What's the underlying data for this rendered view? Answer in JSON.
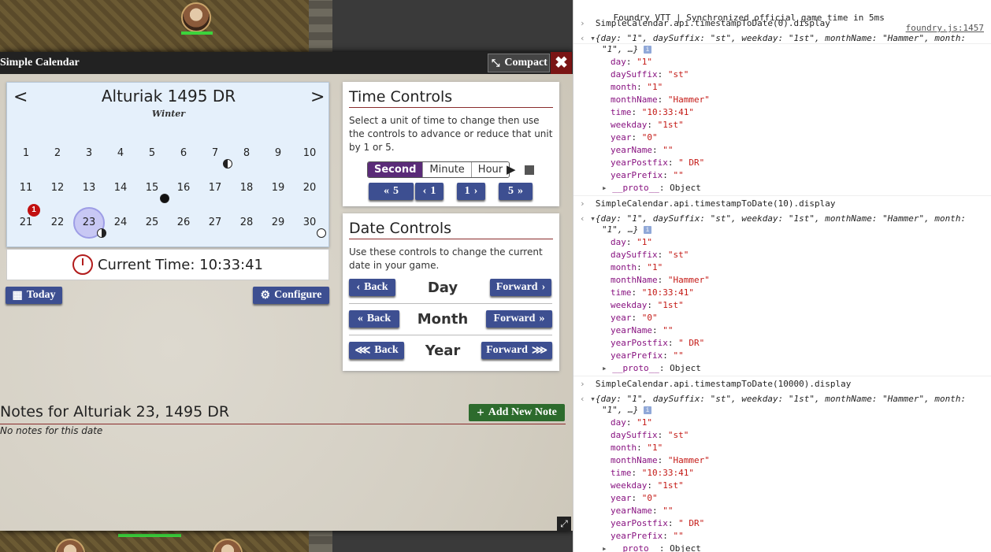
{
  "window": {
    "title": "Simple Calendar",
    "compact_label": "Compact",
    "close_symbol": "✖"
  },
  "calendar": {
    "title": "Alturiak 1495 DR",
    "season": "Winter",
    "prev_arrow": "<",
    "next_arrow": ">",
    "days": [
      "1",
      "2",
      "3",
      "4",
      "5",
      "6",
      "7",
      "8",
      "9",
      "10",
      "11",
      "12",
      "13",
      "14",
      "15",
      "16",
      "17",
      "18",
      "19",
      "20",
      "21",
      "22",
      "23",
      "24",
      "25",
      "26",
      "27",
      "28",
      "29",
      "30"
    ],
    "selected_day": "23",
    "note_badge_day": "21",
    "note_badge_count": "1"
  },
  "current_time": {
    "label": "Current Time: 10:33:41"
  },
  "buttons": {
    "today": "Today",
    "configure": "Configure"
  },
  "time_controls": {
    "title": "Time Controls",
    "description": "Select a unit of time to change then use the controls to advance or reduce that unit by 1 or 5.",
    "units": [
      "Second",
      "Minute",
      "Hour"
    ],
    "active_unit": "Second",
    "back5": "5",
    "back1": "1",
    "fwd1": "1",
    "fwd5": "5"
  },
  "date_controls": {
    "title": "Date Controls",
    "description": "Use these controls to change the current date in your game.",
    "rows": [
      {
        "label": "Day",
        "back": "Back",
        "forward": "Forward"
      },
      {
        "label": "Month",
        "back": "Back",
        "forward": "Forward"
      },
      {
        "label": "Year",
        "back": "Back",
        "forward": "Forward"
      }
    ]
  },
  "notes": {
    "title": "Notes for Alturiak 23, 1495 DR",
    "empty": "No notes for this date",
    "add_label": "Add New Note"
  },
  "console": {
    "log_message": "Foundry VTT | Synchronized official game time in 5ms",
    "log_source": "foundry.js:1457",
    "commands": [
      "SimpleCalendar.api.timestampToDate(0).display",
      "SimpleCalendar.api.timestampToDate(10).display",
      "SimpleCalendar.api.timestampToDate(10000).display"
    ],
    "summary_line1": "{day: \"1\", daySuffix: \"st\", weekday: \"1st\", monthName: \"Hammer\", month:",
    "summary_line2": "\"1\", …}",
    "props": [
      {
        "k": "day",
        "v": "\"1\""
      },
      {
        "k": "daySuffix",
        "v": "\"st\""
      },
      {
        "k": "month",
        "v": "\"1\""
      },
      {
        "k": "monthName",
        "v": "\"Hammer\""
      },
      {
        "k": "time",
        "v": "\"10:33:41\""
      },
      {
        "k": "weekday",
        "v": "\"1st\""
      },
      {
        "k": "year",
        "v": "\"0\""
      },
      {
        "k": "yearName",
        "v": "\"\""
      },
      {
        "k": "yearPostfix",
        "v": "\" DR\""
      },
      {
        "k": "yearPrefix",
        "v": "\"\""
      }
    ],
    "proto_label": "__proto__",
    "proto_value": "Object"
  },
  "colors": {
    "accent_blue": "#3d4f91",
    "add_green": "#2d6b2d",
    "active_unit": "#5a2b78",
    "close_red": "#7a1414"
  }
}
